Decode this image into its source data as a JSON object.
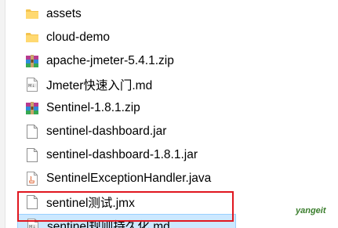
{
  "files": [
    {
      "name": "assets",
      "icon": "folder-icon"
    },
    {
      "name": "cloud-demo",
      "icon": "folder-icon"
    },
    {
      "name": "apache-jmeter-5.4.1.zip",
      "icon": "zip-archive-icon"
    },
    {
      "name": "Jmeter快速入门.md",
      "icon": "markdown-file-icon"
    },
    {
      "name": "Sentinel-1.8.1.zip",
      "icon": "zip-archive-icon"
    },
    {
      "name": "sentinel-dashboard.jar",
      "icon": "blank-file-icon"
    },
    {
      "name": "sentinel-dashboard-1.8.1.jar",
      "icon": "blank-file-icon"
    },
    {
      "name": "SentinelExceptionHandler.java",
      "icon": "java-file-icon"
    },
    {
      "name": "sentinel测试.jmx",
      "icon": "blank-file-icon"
    },
    {
      "name": "sentinel规则持久化.md",
      "icon": "markdown-file-icon"
    }
  ],
  "watermark": "yangeit",
  "colors": {
    "selection_bg": "#cce8ff",
    "selection_border": "#99d1ff",
    "highlight_border": "#e0161f",
    "folder": "#f4c34e"
  }
}
